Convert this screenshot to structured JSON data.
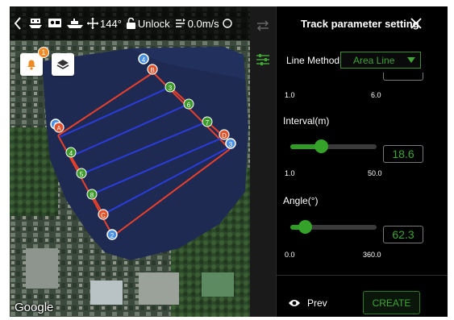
{
  "top_bar": {
    "back_icon": "chevron-left-icon",
    "heading": "144°",
    "lock_status": "Unlock",
    "speed": "0.0m/s"
  },
  "map": {
    "alarm_badge": "1",
    "attribution": "Google",
    "markers": [
      {
        "label": "A",
        "color": "#e0522a",
        "pin": "#4a90e2",
        "pin_label": "1"
      },
      {
        "label": "B",
        "color": "#e0522a",
        "pin": "#4a90e2",
        "pin_label": "4"
      },
      {
        "label": "C",
        "color": "#e0522a",
        "pin": "#4a90e2",
        "pin_label": "2"
      },
      {
        "label": "D",
        "color": "#e0522a",
        "pin": "#4a90e2",
        "pin_label": "3"
      }
    ],
    "waypoints": [
      "3",
      "6",
      "7",
      "4",
      "5",
      "8"
    ],
    "colors": {
      "boundary": "#e8402a",
      "track": "#2a3cdc",
      "waypoint": "#3e9a2a"
    }
  },
  "panel": {
    "title": "Track parameter setting",
    "line_method_label": "Line Method",
    "line_method_value": "Area Line",
    "first_slider": {
      "min": "1.0",
      "max": "6.0"
    },
    "interval": {
      "label": "Interval(m)",
      "value": "18.6",
      "min": "1.0",
      "max": "50.0",
      "level": 0.36
    },
    "angle": {
      "label": "Angle(°)",
      "value": "62.3",
      "min": "0.0",
      "max": "360.0",
      "level": 0.17
    },
    "prev_label": "Prev",
    "create_label": "CREATE"
  },
  "colors": {
    "accent": "#3fa535",
    "panel_bg": "#000000"
  }
}
